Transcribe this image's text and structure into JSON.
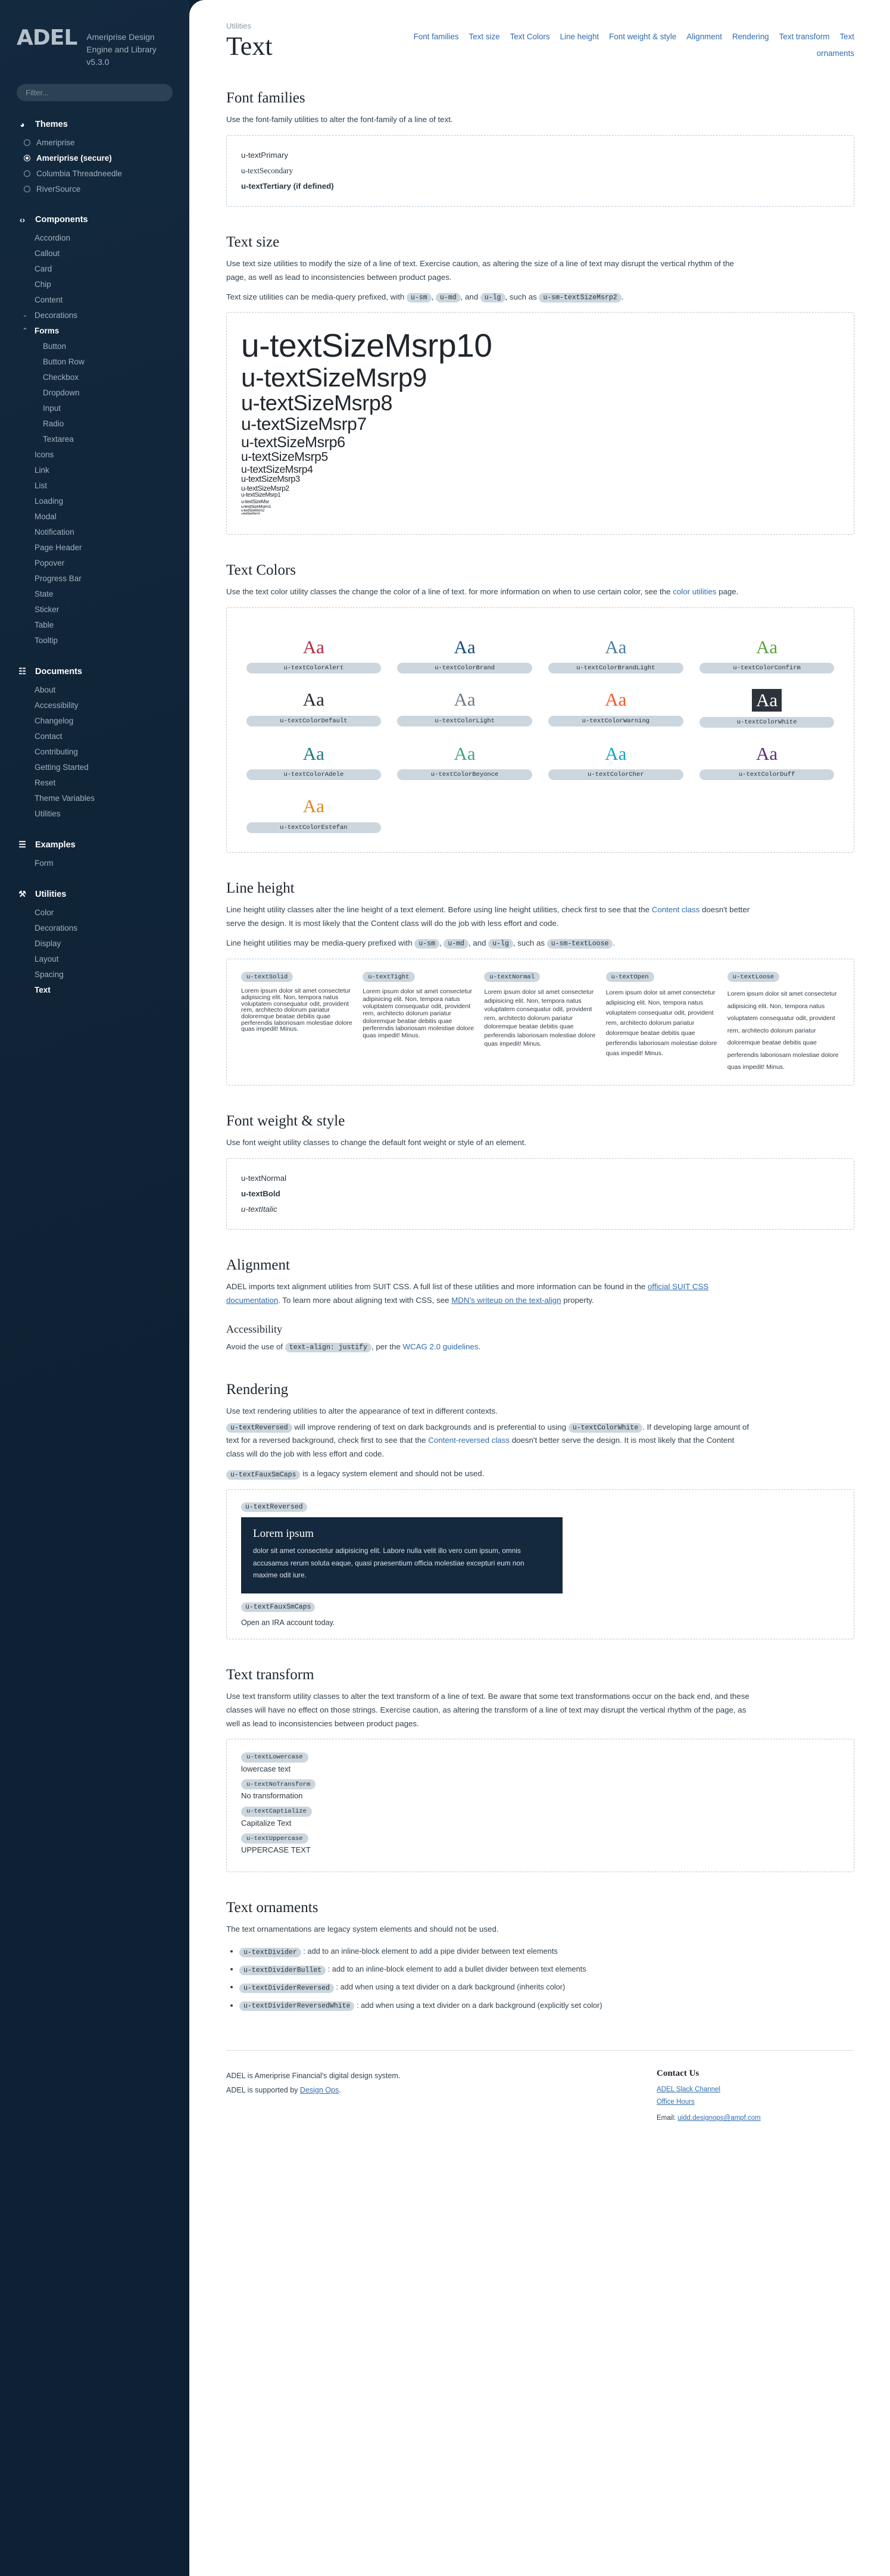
{
  "sidebar": {
    "logo": "ADEL",
    "subtitle": "Ameriprise Design Engine and Library v5.3.0",
    "filter_placeholder": "Filter...",
    "groups": [
      {
        "label": "Themes",
        "icon": "palette-icon",
        "items": [
          {
            "label": "Ameriprise",
            "selected": false
          },
          {
            "label": "Ameriprise (secure)",
            "selected": true
          },
          {
            "label": "Columbia Threadneedle",
            "selected": false
          },
          {
            "label": "RiverSource",
            "selected": false
          }
        ]
      },
      {
        "label": "Components",
        "icon": "code-icon",
        "items": [
          {
            "label": "Accordion"
          },
          {
            "label": "Callout"
          },
          {
            "label": "Card"
          },
          {
            "label": "Chip"
          },
          {
            "label": "Content"
          },
          {
            "label": "Decorations",
            "caret": "chevron-down"
          },
          {
            "label": "Forms",
            "caret": "chevron-up",
            "bold": true
          },
          {
            "label": "Button",
            "level": 2
          },
          {
            "label": "Button Row",
            "level": 2
          },
          {
            "label": "Checkbox",
            "level": 2
          },
          {
            "label": "Dropdown",
            "level": 2
          },
          {
            "label": "Input",
            "level": 2
          },
          {
            "label": "Radio",
            "level": 2
          },
          {
            "label": "Textarea",
            "level": 2
          },
          {
            "label": "Icons"
          },
          {
            "label": "Link"
          },
          {
            "label": "List"
          },
          {
            "label": "Loading"
          },
          {
            "label": "Modal"
          },
          {
            "label": "Notification"
          },
          {
            "label": "Page Header"
          },
          {
            "label": "Popover"
          },
          {
            "label": "Progress Bar"
          },
          {
            "label": "State"
          },
          {
            "label": "Sticker"
          },
          {
            "label": "Table"
          },
          {
            "label": "Tooltip"
          }
        ]
      },
      {
        "label": "Documents",
        "icon": "book-icon",
        "items": [
          {
            "label": "About"
          },
          {
            "label": "Accessibility"
          },
          {
            "label": "Changelog"
          },
          {
            "label": "Contact"
          },
          {
            "label": "Contributing"
          },
          {
            "label": "Getting Started"
          },
          {
            "label": "Reset"
          },
          {
            "label": "Theme Variables"
          },
          {
            "label": "Utilities"
          }
        ]
      },
      {
        "label": "Examples",
        "icon": "grid-icon",
        "items": [
          {
            "label": "Form"
          }
        ]
      },
      {
        "label": "Utilities",
        "icon": "wrench-icon",
        "items": [
          {
            "label": "Color"
          },
          {
            "label": "Decorations"
          },
          {
            "label": "Display"
          },
          {
            "label": "Layout"
          },
          {
            "label": "Spacing"
          },
          {
            "label": "Text",
            "selected": true
          }
        ]
      }
    ]
  },
  "header": {
    "breadcrumb": "Utilities",
    "title": "Text",
    "nav_links": [
      "Font families",
      "Text size",
      "Text Colors",
      "Line height",
      "Font weight & style",
      "Alignment",
      "Rendering",
      "Text transform",
      "Text ornaments"
    ]
  },
  "font_families": {
    "heading": "Font families",
    "intro": "Use the font-family utilities to alter the font-family of a line of text.",
    "items": [
      "u-textPrimary",
      "u-textSecondary",
      "u-textTertiary (if defined)"
    ]
  },
  "text_size": {
    "heading": "Text size",
    "intro": "Use text size utilities to modify the size of a line of text. Exercise caution, as altering the size of a line of text may disrupt the vertical rhythm of the page, as well as lead to inconsistencies between product pages.",
    "prefix_note_pre": "Text size utilities can be media-query prefixed, with",
    "prefix_chips": [
      "u-sm",
      "u-md",
      "u-lg"
    ],
    "prefix_note_mid": ", and",
    "prefix_note_post": ", such as",
    "prefix_example": "u-sm-textSizeMsrp2",
    "samples": [
      {
        "label": "u-textSizeMsrp10",
        "px": 55
      },
      {
        "label": "u-textSizeMsrp9",
        "px": 44
      },
      {
        "label": "u-textSizeMsrp8",
        "px": 36
      },
      {
        "label": "u-textSizeMsrp7",
        "px": 30
      },
      {
        "label": "u-textSizeMsrp6",
        "px": 25
      },
      {
        "label": "u-textSizeMsrp5",
        "px": 21
      },
      {
        "label": "u-textSizeMsrp4",
        "px": 17.5
      },
      {
        "label": "u-textSizeMsrp3",
        "px": 14.5
      },
      {
        "label": "u-textSizeMsrp2",
        "px": 12
      },
      {
        "label": "u-textSizeMsrp1",
        "px": 10
      },
      {
        "label": "u-textSizeMsr",
        "px": 8.5
      },
      {
        "label": "u-textSizeMsrm1",
        "px": 7.5
      },
      {
        "label": "u-textSizeMsrm2",
        "px": 6
      },
      {
        "label": "u-textSizeMsrm3",
        "px": 5
      }
    ]
  },
  "text_colors": {
    "heading": "Text Colors",
    "intro_pre": "Use the text color utility classes the change the color of a line of text. for more information on when to use certain color, see the",
    "intro_link": "color utilities",
    "intro_post": "page.",
    "sample_glyph": "Aa",
    "swatches": [
      {
        "label": "u-textColorAlert",
        "color": "#b7273f",
        "bg": ""
      },
      {
        "label": "u-textColorBrand",
        "color": "#164a7b",
        "bg": ""
      },
      {
        "label": "u-textColorBrandLight",
        "color": "#4a7ba6",
        "bg": ""
      },
      {
        "label": "u-textColorConfirm",
        "color": "#5aa33a",
        "bg": ""
      },
      {
        "label": "u-textColorDefault",
        "color": "#23292f",
        "bg": ""
      },
      {
        "label": "u-textColorLight",
        "color": "#6f7a84",
        "bg": ""
      },
      {
        "label": "u-textColorWarning",
        "color": "#f15a2b",
        "bg": ""
      },
      {
        "label": "u-textColorWhite",
        "color": "#ffffff",
        "bg": "#2c333a"
      },
      {
        "label": "u-textColorAdele",
        "color": "#1a7a86",
        "bg": ""
      },
      {
        "label": "u-textColorBeyonce",
        "color": "#46a08b",
        "bg": ""
      },
      {
        "label": "u-textColorCher",
        "color": "#11a6c4",
        "bg": ""
      },
      {
        "label": "u-textColorDuff",
        "color": "#5b2d77",
        "bg": ""
      },
      {
        "label": "u-textColorEstefan",
        "color": "#e2871a",
        "bg": ""
      }
    ]
  },
  "line_height": {
    "heading": "Line height",
    "intro_pre": "Line height utility classes alter the line height of a text element. Before using line height utilities, check first to see that the",
    "intro_link": "Content class",
    "intro_post": "doesn't better serve the design. It is most likely that the Content class will do the job with less effort and code.",
    "prefix_note_pre": "Line height utilities may be media-query prefixed with",
    "prefix_chips": [
      "u-sm",
      "u-md",
      "u-lg"
    ],
    "prefix_note_mid": ", and",
    "prefix_note_post": ", such as",
    "prefix_example": "u-sm-textLoose",
    "lorem": "Lorem ipsum dolor sit amet consectetur adipisicing elit. Non, tempora natus voluptatem consequatur odit, provident rem, architecto dolorum pariatur doloremque beatae debitis quae perferendis laboriosam molestiae dolore quas impedit! Minus.",
    "columns": [
      "u-textSolid",
      "u-textTight",
      "u-textNormal",
      "u-textOpen",
      "u-textLoose"
    ]
  },
  "font_weight": {
    "heading": "Font weight & style",
    "intro": "Use font weight utility classes to change the default font weight or style of an element.",
    "items": [
      "u-textNormal",
      "u-textBold",
      "u-textItalic"
    ]
  },
  "alignment": {
    "heading": "Alignment",
    "intro_pre": "ADEL imports text alignment utilities from SUIT CSS. A full list of these utilities and more information can be found in the",
    "link1": "official SUIT CSS documentation",
    "intro_mid": ". To learn more about aligning text with CSS, see",
    "link2": "MDN's writeup on the text-align",
    "intro_post": "property.",
    "accessibility_heading": "Accessibility",
    "accessibility_pre": "Avoid the use of",
    "accessibility_chip": "text-align: justify",
    "accessibility_mid": ", per the",
    "accessibility_link": "WCAG 2.0 guidelines",
    "accessibility_post": "."
  },
  "rendering": {
    "heading": "Rendering",
    "intro": "Use text rendering utilities to alter the appearance of text in different contexts.",
    "chip1": "u-textReversed",
    "line1_mid": "will improve rendering of text on dark backgrounds and is preferential to using",
    "chip2": "u-textColorWhite",
    "line1_post": ". If developing large amount of text for a reversed background, check first to see that the",
    "link": "Content-reversed class",
    "line1_end": "doesn't better serve the design. It is most likely that the Content class will do the job with less effort and code.",
    "chip3": "u-textFauxSmCaps",
    "line2": "is a legacy system element and should not be used.",
    "demo_tag1": "u-textReversed",
    "reversed_title": "Lorem ipsum",
    "reversed_body": "dolor sit amet consectetur adipisicing elit. Labore nulla velit illo vero cum ipsum, omnis accusamus rerum soluta eaque, quasi praesentium officia molestiae excepturi eum non maxime odit iure.",
    "demo_tag2": "u-textFauxSmCaps",
    "smcaps_pre": "Open an",
    "smcaps_word": "IRA",
    "smcaps_post": "account today."
  },
  "text_transform": {
    "heading": "Text transform",
    "intro": "Use text transform utility classes to alter the text transform of a line of text. Be aware that some text transformations occur on the back end, and these classes will have no effect on those strings. Exercise caution, as altering the transform of a line of text may disrupt the vertical rhythm of the page, as well as lead to inconsistencies between product pages.",
    "rows": [
      {
        "tag": "u-textLowercase",
        "value": "lowercase text"
      },
      {
        "tag": "u-textNoTransform",
        "value": "No transformation"
      },
      {
        "tag": "u-textCaptialize",
        "value": "Capitalize Text"
      },
      {
        "tag": "u-textUppercase",
        "value": "UPPERCASE TEXT"
      }
    ]
  },
  "text_ornaments": {
    "heading": "Text ornaments",
    "intro": "The text ornamentations are legacy system elements and should not be used.",
    "items": [
      {
        "tag": "u-textDivider",
        "desc": ": add to an inline-block element to add a pipe divider between text elements"
      },
      {
        "tag": "u-textDividerBullet",
        "desc": ": add to an inline-block element to add a bullet divider between text elements"
      },
      {
        "tag": "u-textDividerReversed",
        "desc": ": add when using a text divider on a dark background (inherits color)"
      },
      {
        "tag": "u-textDividerReversedWhite",
        "desc": ": add when using a text divider on a dark background (explicitly set color)"
      }
    ]
  },
  "footer": {
    "line1": "ADEL is Ameriprise Financial's digital design system.",
    "line2_pre": "ADEL is supported by",
    "line2_link": "Design Ops",
    "line2_post": ".",
    "contact_heading": "Contact Us",
    "links": [
      "ADEL Slack Channel",
      "Office Hours"
    ],
    "email_label": "Email:",
    "email": "uidd.designops@ampf.com"
  }
}
